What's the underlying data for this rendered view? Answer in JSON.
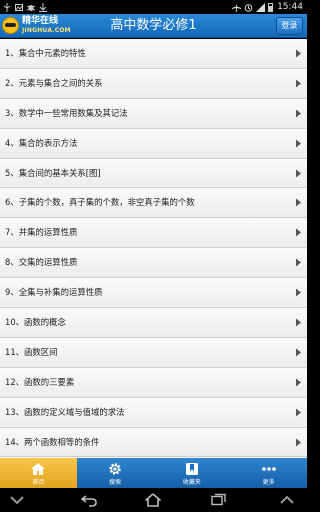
{
  "status_bar": {
    "time": "15:44",
    "icons": [
      "usb-icon",
      "image-icon",
      "bug-icon",
      "download-icon",
      "airplane-mode-icon",
      "alarm-icon",
      "signal-icon",
      "battery-icon"
    ]
  },
  "header": {
    "logo_cn": "精华在线",
    "logo_en": "JINGHUA.COM",
    "title": "高中数学必修1",
    "login_label": "登录"
  },
  "list": {
    "items": [
      {
        "label": "1、集合中元素的特性"
      },
      {
        "label": "2、元素与集合之间的关系"
      },
      {
        "label": "3、数学中一些常用数集及其记法"
      },
      {
        "label": "4、集合的表示方法"
      },
      {
        "label": "5、集合间的基本关系[图]"
      },
      {
        "label": "6、子集的个数，真子集的个数，非空真子集的个数"
      },
      {
        "label": "7、并集的运算性质"
      },
      {
        "label": "8、交集的运算性质"
      },
      {
        "label": "9、全集与补集的运算性质"
      },
      {
        "label": "10、函数的概念"
      },
      {
        "label": "11、函数区间"
      },
      {
        "label": "12、函数的三要素"
      },
      {
        "label": "13、函数的定义域与值域的求法"
      },
      {
        "label": "14、两个函数相等的条件"
      }
    ]
  },
  "tabbar": {
    "tabs": [
      {
        "label": "首页",
        "icon": "home-icon"
      },
      {
        "label": "搜索",
        "icon": "gear-icon"
      },
      {
        "label": "收藏夹",
        "icon": "bookmark-icon"
      },
      {
        "label": "更多",
        "icon": "more-icon"
      }
    ]
  },
  "colors": {
    "header_blue": "#1a72c4",
    "tab_active": "#e9ad2c",
    "list_bg": "#f4f4f4"
  }
}
